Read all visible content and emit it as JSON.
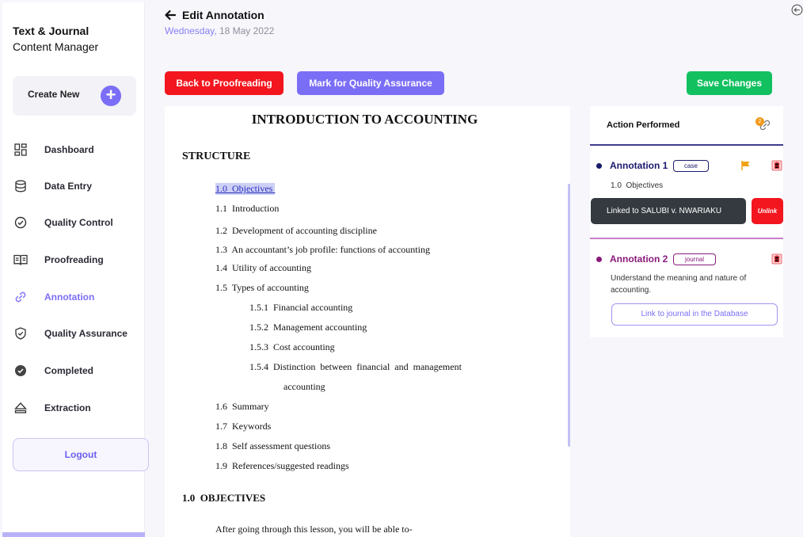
{
  "brand": {
    "line1": "Text & Journal",
    "line2": "Content Manager"
  },
  "create_new": {
    "label": "Create New",
    "icon": "plus-circle-icon"
  },
  "nav": [
    {
      "label": "Dashboard",
      "icon": "dashboard-grid-icon",
      "active": false
    },
    {
      "label": "Data Entry",
      "icon": "database-icon",
      "active": false
    },
    {
      "label": "Quality Control",
      "icon": "check-circle-icon",
      "active": false
    },
    {
      "label": "Proofreading",
      "icon": "book-open-icon",
      "active": false
    },
    {
      "label": "Annotation",
      "icon": "link-icon",
      "active": true
    },
    {
      "label": "Quality Assurance",
      "icon": "shield-check-icon",
      "active": false
    },
    {
      "label": "Completed",
      "icon": "check-filled-circle-icon",
      "active": false
    },
    {
      "label": "Extraction",
      "icon": "eject-icon",
      "active": false
    }
  ],
  "logout_label": "Logout",
  "header": {
    "title": "Edit Annotation",
    "weekday": "Wednesday,",
    "date": " 18 May 2022"
  },
  "actions": {
    "back_to_proofreading": "Back to Proofreading",
    "mark_qa": "Mark for Quality Assurance",
    "save": "Save Changes"
  },
  "colors": {
    "accent": "#7b6ef6",
    "danger": "#f3161f",
    "success": "#12c060",
    "dark": "#343a40"
  },
  "document": {
    "title": "INTRODUCTION TO ACCOUNTING",
    "structure_heading": "STRUCTURE",
    "toc": [
      {
        "num": "1.0",
        "text": "Objectives",
        "highlighted": true
      },
      {
        "num": "1.1",
        "text": "Introduction"
      },
      {
        "num": "1.2",
        "text": "Development of accounting discipline"
      },
      {
        "num": "1.3",
        "text": "An accountant’s job profile: functions of accounting"
      },
      {
        "num": "1.4",
        "text": "Utility of accounting"
      },
      {
        "num": "1.5",
        "text": "Types of accounting"
      },
      {
        "num": "1.5.1",
        "text": "Financial accounting"
      },
      {
        "num": "1.5.2",
        "text": "Management accounting"
      },
      {
        "num": "1.5.3",
        "text": "Cost accounting"
      },
      {
        "num": "1.5.4",
        "text": "Distinction  between  financial  and  management"
      },
      {
        "num": "",
        "text": "accounting"
      },
      {
        "num": "1.6",
        "text": "Summary"
      },
      {
        "num": "1.7",
        "text": "Keywords"
      },
      {
        "num": "1.8",
        "text": "Self assessment questions"
      },
      {
        "num": "1.9",
        "text": "References/suggested readings"
      }
    ],
    "objectives_heading": "1.0  OBJECTIVES",
    "objectives_intro": "After going through this lesson, you will be able to-"
  },
  "panel": {
    "title": "Action Performed",
    "badge_count": "2",
    "annotations": [
      {
        "title": "Annotation 1",
        "tag": "case",
        "text": "1.0  Objectives",
        "linked_label": "Linked to SALUBI v. NWARIAKU",
        "unlink_label": "Unlink"
      },
      {
        "title": "Annotation 2",
        "tag": "journal",
        "text_line1": "Understand the meaning and nature of",
        "text_line2": "accounting.",
        "link_label": "Link to journal in the Database"
      }
    ]
  }
}
